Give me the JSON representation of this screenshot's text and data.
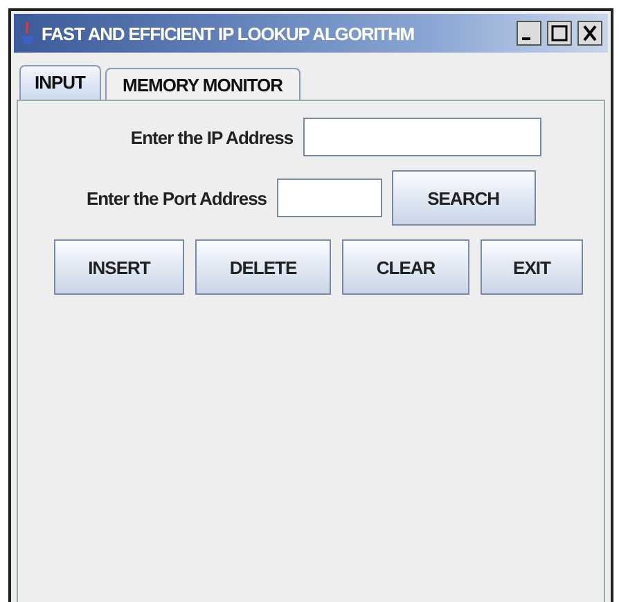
{
  "window": {
    "title": "FAST AND EFFICIENT IP LOOKUP ALGORITHM"
  },
  "tabs": [
    {
      "label": "INPUT",
      "selected": true
    },
    {
      "label": "MEMORY MONITOR",
      "selected": false
    }
  ],
  "fields": [
    {
      "label": "Enter the IP Address",
      "kind": "wide"
    },
    {
      "label": "Enter the Port Address",
      "kind": "narrow",
      "button": "SEARCH"
    }
  ],
  "buttons": [
    "INSERT",
    "DELETE",
    "CLEAR",
    "EXIT"
  ]
}
